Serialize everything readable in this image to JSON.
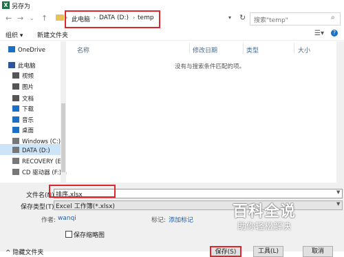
{
  "window": {
    "title": "另存为",
    "app_icon_letter": "X"
  },
  "address": {
    "crumbs": [
      "此电脑",
      "DATA (D:)",
      "temp"
    ],
    "separator": "›"
  },
  "search": {
    "placeholder": "搜索\"temp\""
  },
  "toolbar": {
    "organize": "组织 ▾",
    "new_folder": "新建文件夹"
  },
  "nav": {
    "items": [
      {
        "label": "OneDrive",
        "icon": "cloud-icon",
        "color": "#1c6fc7"
      },
      {
        "label": "此电脑",
        "icon": "computer-icon",
        "color": "#2b579a"
      },
      {
        "label": "视频",
        "icon": "video-icon",
        "color": "#555"
      },
      {
        "label": "图片",
        "icon": "picture-icon",
        "color": "#555"
      },
      {
        "label": "文档",
        "icon": "document-icon",
        "color": "#555"
      },
      {
        "label": "下载",
        "icon": "download-icon",
        "color": "#1c6fc7"
      },
      {
        "label": "音乐",
        "icon": "music-icon",
        "color": "#1c6fc7"
      },
      {
        "label": "桌面",
        "icon": "desktop-icon",
        "color": "#1c6fc7"
      },
      {
        "label": "Windows (C:)",
        "icon": "drive-icon",
        "color": "#777"
      },
      {
        "label": "DATA (D:)",
        "icon": "drive-icon",
        "color": "#777"
      },
      {
        "label": "RECOVERY (E:)",
        "icon": "drive-icon",
        "color": "#777"
      },
      {
        "label": "CD 驱动器 (F:) a",
        "icon": "cd-drive-icon",
        "color": "#777"
      }
    ]
  },
  "list": {
    "columns": [
      "名称",
      "修改日期",
      "类型",
      "大小"
    ],
    "empty_message": "没有与搜索条件匹配的项。"
  },
  "form": {
    "filename_label": "文件名(N):",
    "filename_value": "排序.xlsx",
    "filetype_label": "保存类型(T):",
    "filetype_value": "Excel 工作簿(*.xlsx)",
    "author_label": "作者:",
    "author_value": "wanqi",
    "tags_label": "标记:",
    "tags_value": "添加标记",
    "thumbnail_label": "保存缩略图",
    "hide_folders": "^ 隐藏文件夹",
    "save_button": "保存(S)",
    "tools_button": "工具(L)",
    "cancel_button": "取消"
  },
  "watermark": {
    "line1": "百科全说",
    "line2": "助你轻松解决"
  }
}
